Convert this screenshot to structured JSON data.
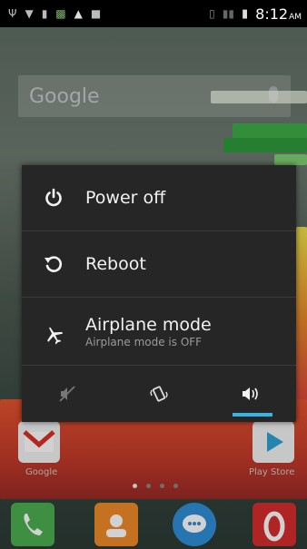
{
  "status_bar": {
    "time": "8:12",
    "ampm": "AM",
    "icons": [
      "usb-icon",
      "wifi-icon",
      "battery-small-icon",
      "image-icon",
      "warning-icon",
      "square-icon",
      "vibrate-icon",
      "signal-icon",
      "battery-icon"
    ]
  },
  "search_widget": {
    "text": "Google"
  },
  "power_menu": {
    "items": [
      {
        "label": "Power off",
        "icon": "power-icon"
      },
      {
        "label": "Reboot",
        "icon": "reboot-icon"
      },
      {
        "label": "Airplane mode",
        "sublabel": "Airplane mode is OFF",
        "icon": "airplane-icon"
      }
    ],
    "sound_modes": [
      {
        "mode": "silent",
        "icon": "silent-icon",
        "selected": false
      },
      {
        "mode": "vibrate",
        "icon": "vibrate-icon",
        "selected": false
      },
      {
        "mode": "sound",
        "icon": "sound-on-icon",
        "selected": true
      }
    ]
  },
  "home_apps": [
    {
      "label": "Google"
    },
    {
      "label": "Play Store"
    }
  ],
  "colors": {
    "accent": "#33b5e5",
    "dialog_bg": "#262626"
  }
}
